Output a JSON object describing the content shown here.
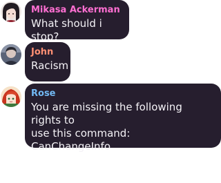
{
  "messages": [
    {
      "sender": "Mikasa Ackerman",
      "text": "What should i stop?",
      "name_color": "#ff6fd2",
      "avatar": "girl-dark-hair-avatar-icon"
    },
    {
      "sender": "John",
      "text": "Racism",
      "name_color": "#ff8f73",
      "avatar": "person-avatar-icon"
    },
    {
      "sender": "Rose",
      "text": "You are missing the following rights to\nuse this command:\nCanChangeInfo",
      "name_color": "#72b9f4",
      "avatar": "red-hair-girl-avatar-icon"
    }
  ],
  "colors": {
    "bubble_background": "#261e2e",
    "message_text": "#f4f2f6",
    "page_background": "#ffffff"
  }
}
